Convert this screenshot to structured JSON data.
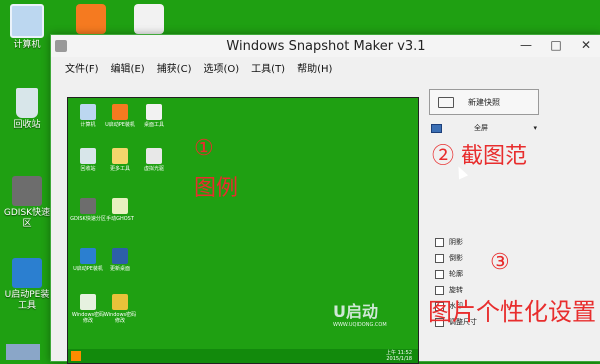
{
  "desktop": {
    "icons": [
      {
        "label": "计算机"
      },
      {
        "label": "回收站"
      },
      {
        "label": "GDISK快速\n区"
      },
      {
        "label": "U启动PE装\n工具"
      }
    ]
  },
  "window": {
    "title": "Windows Snapshot Maker v3.1",
    "controls": {
      "minimize": "—",
      "maximize": "□",
      "close": "✕"
    },
    "menu": [
      "文件(F)",
      "编辑(E)",
      "捕获(C)",
      "选项(O)",
      "工具(T)",
      "帮助(H)"
    ]
  },
  "preview": {
    "icons": [
      {
        "label": "计算机"
      },
      {
        "label": "U启动PE装机"
      },
      {
        "label": "桌面工具"
      },
      {
        "label": "回收站"
      },
      {
        "label": "更多工具"
      },
      {
        "label": "虚拟光驱"
      },
      {
        "label": "GDISK快速分区"
      },
      {
        "label": "手动GHOST"
      },
      {
        "label": "U启动PE装机"
      },
      {
        "label": "更新桌面"
      },
      {
        "label": "Windows密码修改"
      },
      {
        "label": "Windows密码修改"
      }
    ],
    "logo": "U启动",
    "logo_sub": "WWW.UQIDONG.COM",
    "clock": "上午 11:52",
    "date": "2015/1/18"
  },
  "panel": {
    "new_snapshot": "新建快照",
    "mode": "全屏",
    "options": [
      "阴影",
      "倒影",
      "轮廓",
      "旋转",
      "水印",
      "调整尺寸"
    ]
  },
  "annotations": {
    "a1_num": "①",
    "a1_text": "图例",
    "a2": "② 截图范",
    "a3": "③",
    "a4": "图片个性化设置"
  }
}
